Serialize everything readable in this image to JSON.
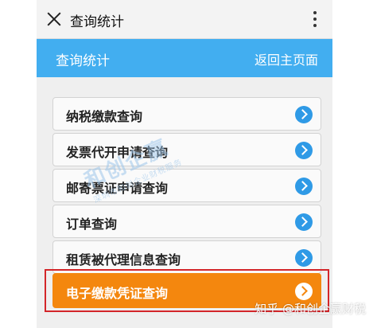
{
  "topbar": {
    "title": "查询统计"
  },
  "header": {
    "title": "查询统计",
    "home_link": "返回主页面"
  },
  "menu": [
    {
      "label": "纳税缴款查询"
    },
    {
      "label": "发票代开申请查询"
    },
    {
      "label": "邮寄票证申请查询"
    },
    {
      "label": "订单查询"
    },
    {
      "label": "租赁被代理信息查询"
    },
    {
      "label": "电子缴款凭证查询"
    }
  ],
  "watermark": {
    "main": "和创企赢",
    "sub": "深圳市和创企业财税服务"
  },
  "credit": "知乎 @和创企赢财税",
  "colors": {
    "header": "#42aef0",
    "active_item": "#f4870e",
    "highlight": "#d3262a",
    "chevron": "#2f9ae6"
  }
}
